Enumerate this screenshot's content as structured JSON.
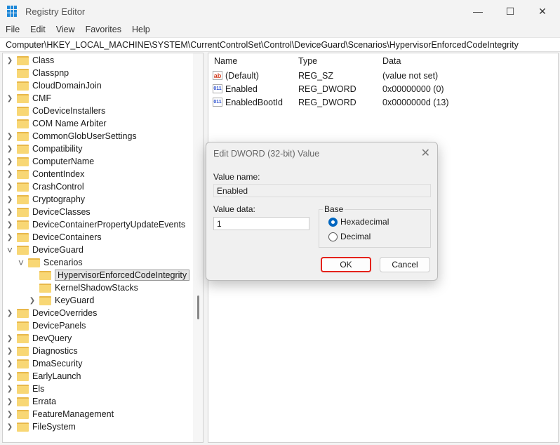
{
  "window": {
    "title": "Registry Editor"
  },
  "menu": [
    "File",
    "Edit",
    "View",
    "Favorites",
    "Help"
  ],
  "address": "Computer\\HKEY_LOCAL_MACHINE\\SYSTEM\\CurrentControlSet\\Control\\DeviceGuard\\Scenarios\\HypervisorEnforcedCodeIntegrity",
  "tree": [
    {
      "label": "Class",
      "level": 0,
      "exp": ">"
    },
    {
      "label": "Classpnp",
      "level": 0,
      "exp": ""
    },
    {
      "label": "CloudDomainJoin",
      "level": 0,
      "exp": ""
    },
    {
      "label": "CMF",
      "level": 0,
      "exp": ">"
    },
    {
      "label": "CoDeviceInstallers",
      "level": 0,
      "exp": ""
    },
    {
      "label": "COM Name Arbiter",
      "level": 0,
      "exp": ""
    },
    {
      "label": "CommonGlobUserSettings",
      "level": 0,
      "exp": ">"
    },
    {
      "label": "Compatibility",
      "level": 0,
      "exp": ">"
    },
    {
      "label": "ComputerName",
      "level": 0,
      "exp": ">"
    },
    {
      "label": "ContentIndex",
      "level": 0,
      "exp": ">"
    },
    {
      "label": "CrashControl",
      "level": 0,
      "exp": ">"
    },
    {
      "label": "Cryptography",
      "level": 0,
      "exp": ">"
    },
    {
      "label": "DeviceClasses",
      "level": 0,
      "exp": ">"
    },
    {
      "label": "DeviceContainerPropertyUpdateEvents",
      "level": 0,
      "exp": ">"
    },
    {
      "label": "DeviceContainers",
      "level": 0,
      "exp": ">"
    },
    {
      "label": "DeviceGuard",
      "level": 0,
      "exp": "v"
    },
    {
      "label": "Scenarios",
      "level": 1,
      "exp": "v"
    },
    {
      "label": "HypervisorEnforcedCodeIntegrity",
      "level": 2,
      "exp": "",
      "selected": true
    },
    {
      "label": "KernelShadowStacks",
      "level": 2,
      "exp": ""
    },
    {
      "label": "KeyGuard",
      "level": 2,
      "exp": ">"
    },
    {
      "label": "DeviceOverrides",
      "level": 0,
      "exp": ">"
    },
    {
      "label": "DevicePanels",
      "level": 0,
      "exp": ""
    },
    {
      "label": "DevQuery",
      "level": 0,
      "exp": ">"
    },
    {
      "label": "Diagnostics",
      "level": 0,
      "exp": ">"
    },
    {
      "label": "DmaSecurity",
      "level": 0,
      "exp": ">"
    },
    {
      "label": "EarlyLaunch",
      "level": 0,
      "exp": ">"
    },
    {
      "label": "Els",
      "level": 0,
      "exp": ">"
    },
    {
      "label": "Errata",
      "level": 0,
      "exp": ">"
    },
    {
      "label": "FeatureManagement",
      "level": 0,
      "exp": ">"
    },
    {
      "label": "FileSystem",
      "level": 0,
      "exp": ">"
    }
  ],
  "list": {
    "headers": [
      "Name",
      "Type",
      "Data"
    ],
    "rows": [
      {
        "icon": "ab",
        "name": "(Default)",
        "type": "REG_SZ",
        "data": "(value not set)"
      },
      {
        "icon": "bin",
        "name": "Enabled",
        "type": "REG_DWORD",
        "data": "0x00000000 (0)"
      },
      {
        "icon": "bin",
        "name": "EnabledBootId",
        "type": "REG_DWORD",
        "data": "0x0000000d (13)"
      }
    ]
  },
  "dialog": {
    "title": "Edit DWORD (32-bit) Value",
    "value_name_label": "Value name:",
    "value_name": "Enabled",
    "value_data_label": "Value data:",
    "value_data": "1",
    "base_label": "Base",
    "hex_label": "Hexadecimal",
    "dec_label": "Decimal",
    "selected_base": "Hexadecimal",
    "ok": "OK",
    "cancel": "Cancel"
  }
}
